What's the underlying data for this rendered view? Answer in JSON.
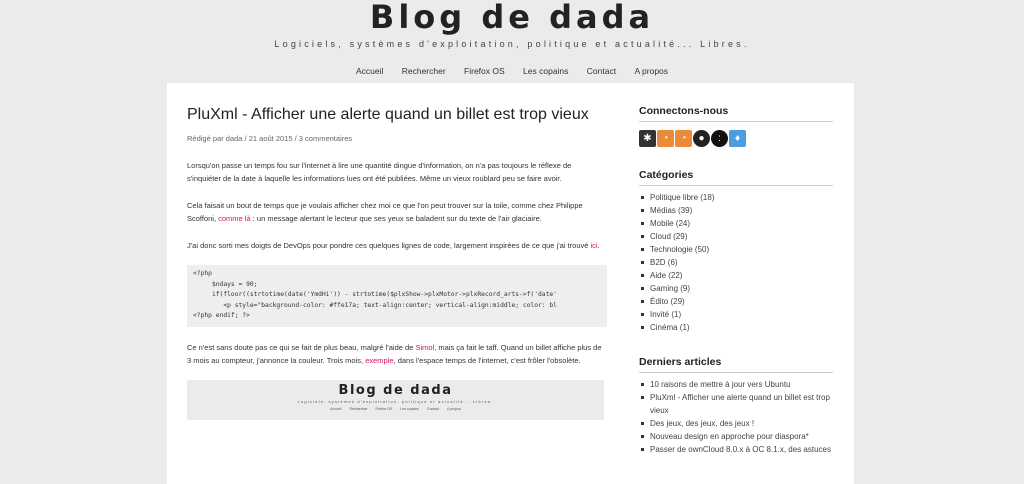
{
  "header": {
    "title": "Blog de dada",
    "tagline": "Logiciels, systèmes d'exploitation, politique et actualité... Libres."
  },
  "nav": [
    "Accueil",
    "Rechercher",
    "Firefox OS",
    "Les copains",
    "Contact",
    "A propos"
  ],
  "post": {
    "title": "PluXml - Afficher une alerte quand un billet est trop vieux",
    "meta_prefix": "Rédigé par ",
    "author": "dada",
    "sep1": " / ",
    "date": "21 août 2015",
    "sep2": " / ",
    "comments": "3 commentaires",
    "p1": "Lorsqu'on passe un temps fou sur l'internet à lire une quantité dingue d'information, on n'a pas toujours le réflexe de s'inquiéter de la date à laquelle les informations lues ont été publiées. Même un vieux roublard peu se faire avoir.",
    "p2_a": "Cela faisait un bout de temps que je voulais afficher chez moi ce que l'on peut trouver sur la toile, comme chez Philippe Scoffoni, ",
    "p2_link": "comme là",
    "p2_b": " : un message alertant le lecteur que ses yeux se baladent sur du texte de l'air glaciaire.",
    "p3_a": "J'ai donc sorti mes doigts de DevOps pour pondre ces quelques lignes de code, largement inspirées de ce que j'ai trouvé ",
    "p3_link": "ici",
    "p3_b": ".",
    "code": "<?php\n     $ndays = 90;\n     if(floor((strtotime(date('YmdHi')) - strtotime($plxShow->plxMotor->plxRecord_arts->f('date'\n        <p style=\"background-color: #ffe17a; text-align:center; vertical-align:middle; color: bl\n<?php endif; ?>",
    "p4_a": "Ce n'est sans doute pas ce qui se fait de plus beau, malgré l'aide de ",
    "p4_link1": "Simol",
    "p4_b": ", mais ça fait le taff. Quand un billet affiche plus de 3 mois au compteur, j'annonce la couleur. Trois mois, ",
    "p4_link2": "exemple",
    "p4_c": ", dans l'espace temps de l'internet, c'est frôler l'obsolète.",
    "embed": {
      "title": "Blog de dada",
      "tagline": "Logiciels, systèmes d'exploitation, politique et actualité... Libres.",
      "nav": [
        "Accueil",
        "Rechercher",
        "Firefox OS",
        "Les copains",
        "Contact",
        "A propos"
      ]
    }
  },
  "sidebar": {
    "connect_title": "Connectons-nous",
    "social": [
      {
        "icon": "diaspora-icon",
        "glyph": "✱",
        "color": "#333333"
      },
      {
        "icon": "rss-icon",
        "glyph": "◔",
        "color": "#e98b39"
      },
      {
        "icon": "rss-comments-icon",
        "glyph": "◔",
        "color": "#e98b39"
      },
      {
        "icon": "github-icon",
        "glyph": "●",
        "color": "#222222"
      },
      {
        "icon": "mastodon-icon",
        "glyph": ":",
        "color": "#111111"
      },
      {
        "icon": "twitter-icon",
        "glyph": "♦",
        "color": "#4a9de0"
      }
    ],
    "categories_title": "Catégories",
    "categories": [
      "Politique libre (18)",
      "Médias (39)",
      "Mobile (24)",
      "Cloud (29)",
      "Technologie (50)",
      "B2D (6)",
      "Aide (22)",
      "Gaming (9)",
      "Édito (29)",
      "Invité (1)",
      "Cinéma (1)"
    ],
    "recent_title": "Derniers articles",
    "recent": [
      "10 raisons de mettre à jour vers Ubuntu",
      "PluXml - Afficher une alerte quand un billet est trop vieux",
      "Des jeux, des jeux, des jeux !",
      "Nouveau design en approche pour diaspora*",
      "Passer de ownCloud 8.0.x à OC 8.1.x, des astuces"
    ]
  }
}
